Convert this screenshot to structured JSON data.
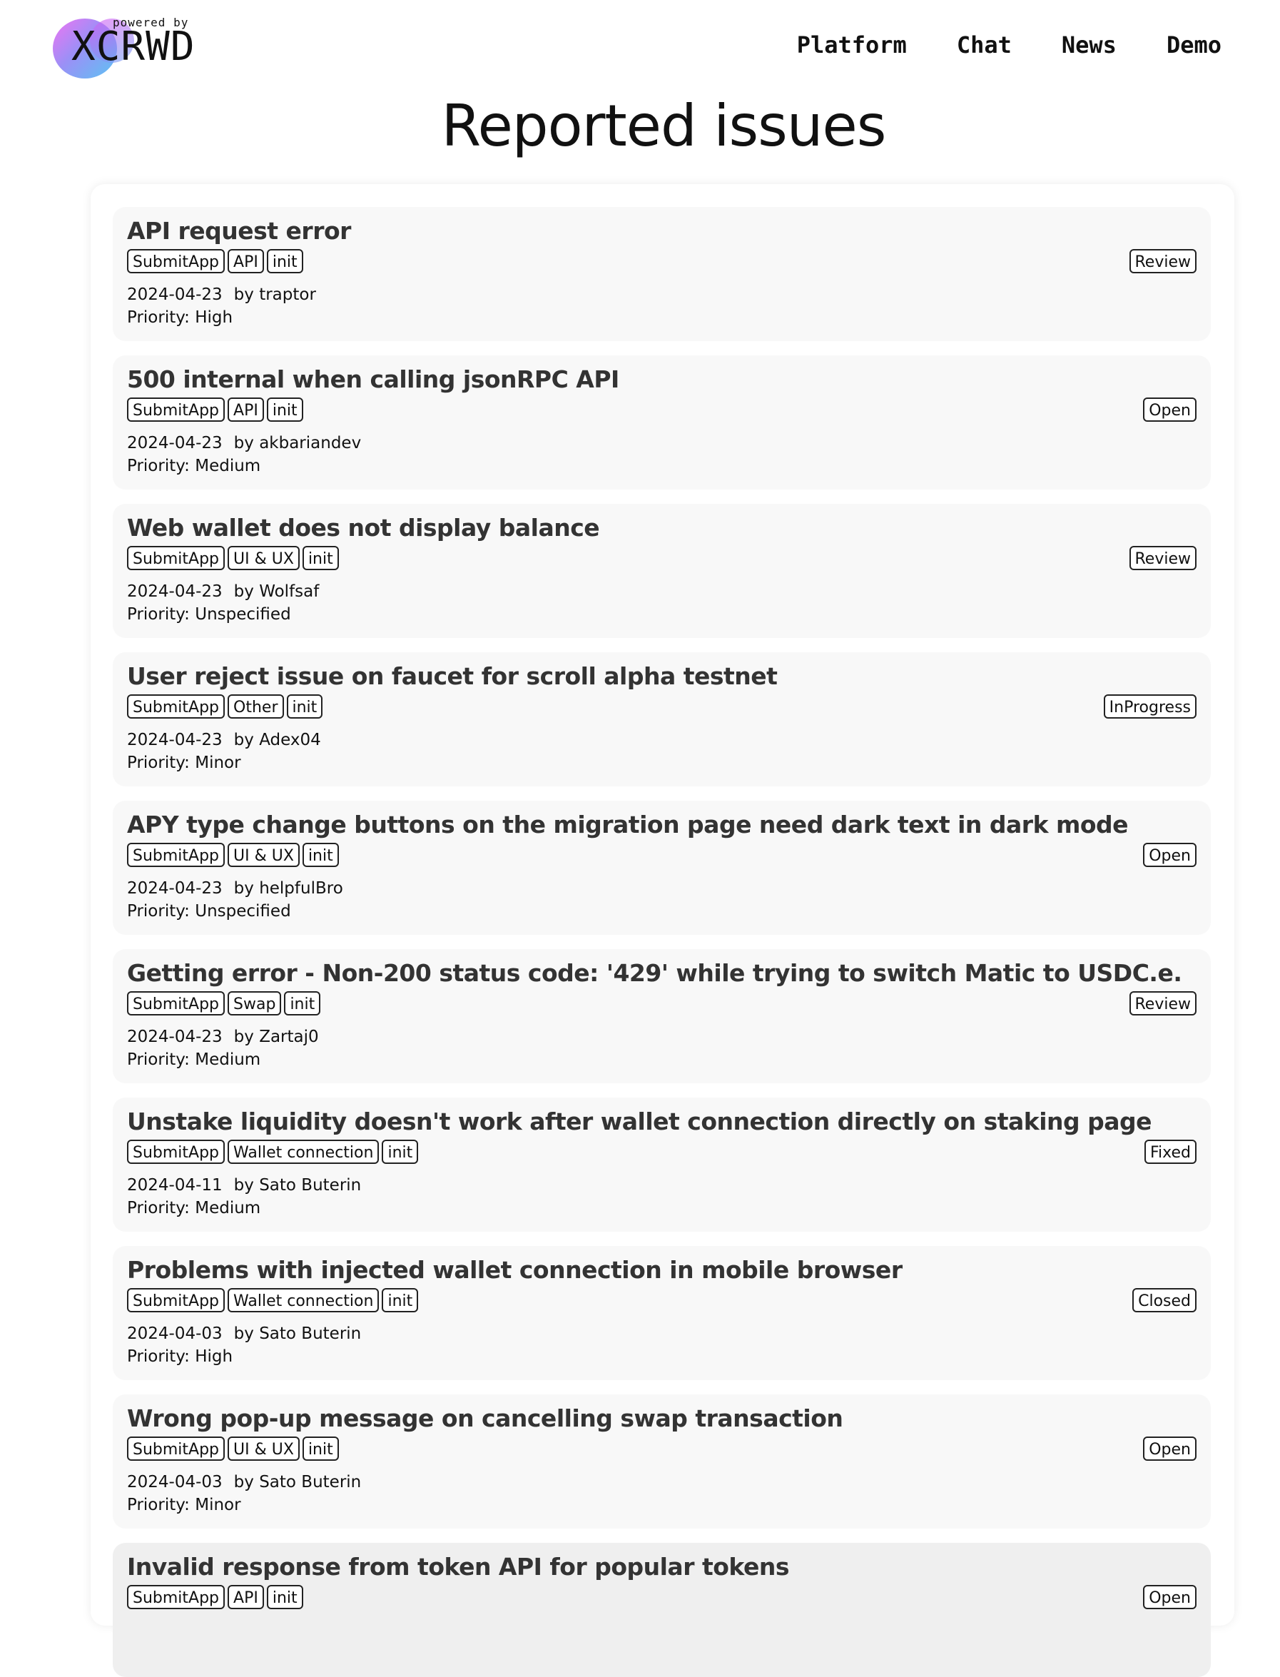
{
  "logo": {
    "powered_by": "powered by",
    "wordmark": "XCRWD"
  },
  "nav": {
    "items": [
      "Platform",
      "Chat",
      "News",
      "Demo"
    ]
  },
  "page": {
    "title": "Reported issues"
  },
  "issues": [
    {
      "title": "API request error",
      "tags": [
        "SubmitApp",
        "API",
        "init"
      ],
      "status": "Review",
      "date": "2024-04-23",
      "author": "by traptor",
      "priority": "Priority: High"
    },
    {
      "title": "500 internal when calling jsonRPC API",
      "tags": [
        "SubmitApp",
        "API",
        "init"
      ],
      "status": "Open",
      "date": "2024-04-23",
      "author": "by akbariandev",
      "priority": "Priority: Medium"
    },
    {
      "title": "Web wallet does not display balance",
      "tags": [
        "SubmitApp",
        "UI & UX",
        "init"
      ],
      "status": "Review",
      "date": "2024-04-23",
      "author": "by Wolfsaf",
      "priority": "Priority: Unspecified"
    },
    {
      "title": "User reject issue on faucet for scroll alpha testnet",
      "tags": [
        "SubmitApp",
        "Other",
        "init"
      ],
      "status": "InProgress",
      "date": "2024-04-23",
      "author": "by Adex04",
      "priority": "Priority: Minor"
    },
    {
      "title": "APY type change buttons on the migration page need dark text in dark mode",
      "tags": [
        "SubmitApp",
        "UI & UX",
        "init"
      ],
      "status": "Open",
      "date": "2024-04-23",
      "author": "by helpfulBro",
      "priority": "Priority: Unspecified"
    },
    {
      "title": "Getting error - Non-200 status code: '429' while trying to switch Matic to USDC.e.",
      "tags": [
        "SubmitApp",
        "Swap",
        "init"
      ],
      "status": "Review",
      "date": "2024-04-23",
      "author": "by Zartaj0",
      "priority": "Priority: Medium"
    },
    {
      "title": "Unstake liquidity doesn't work after wallet connection directly on staking page",
      "tags": [
        "SubmitApp",
        "Wallet connection",
        "init"
      ],
      "status": "Fixed",
      "date": "2024-04-11",
      "author": "by Sato Buterin",
      "priority": "Priority: Medium"
    },
    {
      "title": "Problems with injected wallet connection in mobile browser",
      "tags": [
        "SubmitApp",
        "Wallet connection",
        "init"
      ],
      "status": "Closed",
      "date": "2024-04-03",
      "author": "by Sato Buterin",
      "priority": "Priority: High"
    },
    {
      "title": "Wrong pop-up message on cancelling swap transaction",
      "tags": [
        "SubmitApp",
        "UI & UX",
        "init"
      ],
      "status": "Open",
      "date": "2024-04-03",
      "author": "by Sato Buterin",
      "priority": "Priority: Minor"
    },
    {
      "title": "Invalid response from token API for popular tokens",
      "tags": [
        "SubmitApp",
        "API",
        "init"
      ],
      "status": "Open",
      "date": "",
      "author": "",
      "priority": ""
    }
  ]
}
